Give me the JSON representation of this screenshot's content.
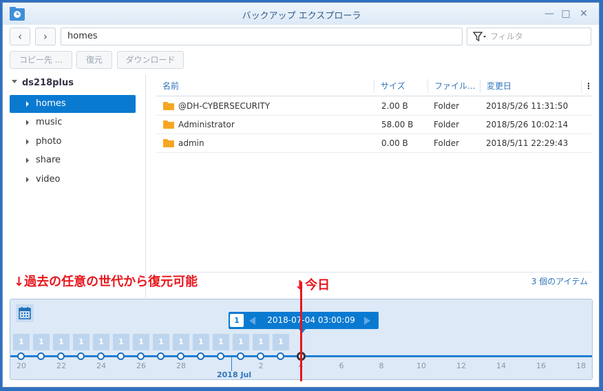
{
  "window": {
    "title": "バックアップ エクスプローラ",
    "minimize_glyph": "—",
    "maximize_glyph": "□",
    "close_glyph": "✕"
  },
  "navigation": {
    "back_glyph": "‹",
    "forward_glyph": "›",
    "path": "homes",
    "filter_placeholder": "フィルタ"
  },
  "actions": {
    "copy_to": "コピー先 ...",
    "restore": "復元",
    "download": "ダウンロード"
  },
  "sidebar": {
    "root": "ds218plus",
    "items": [
      {
        "label": "homes"
      },
      {
        "label": "music"
      },
      {
        "label": "photo"
      },
      {
        "label": "share"
      },
      {
        "label": "video"
      }
    ]
  },
  "table": {
    "headers": {
      "name": "名前",
      "size": "サイズ",
      "type": "ファイル...",
      "modified": "変更日"
    },
    "rows": [
      {
        "name": "@DH-CYBERSECURITY",
        "size": "2.00 B",
        "type": "Folder",
        "modified": "2018/5/26 11:31:50"
      },
      {
        "name": "Administrator",
        "size": "58.00 B",
        "type": "Folder",
        "modified": "2018/5/26 10:02:14"
      },
      {
        "name": "admin",
        "size": "0.00 B",
        "type": "Folder",
        "modified": "2018/5/11 22:29:43"
      }
    ],
    "item_count": "3 個のアイテム"
  },
  "annotations": {
    "left": "↓過去の任意の世代から復元可能",
    "right": "↓今日"
  },
  "timeline": {
    "selected_count": "1",
    "selected_datetime": "2018-07-04 03:00:09",
    "backup_counts": [
      "1",
      "1",
      "1",
      "1",
      "1",
      "1",
      "1",
      "1",
      "1",
      "1",
      "1",
      "1",
      "1",
      "1"
    ],
    "ticks": [
      "20",
      "22",
      "24",
      "26",
      "28",
      "2",
      "4",
      "6",
      "8",
      "10",
      "12",
      "14",
      "16",
      "18"
    ],
    "month_label": "2018 Jul"
  },
  "colors": {
    "accent": "#0a7ad1",
    "annotation_red": "#e8161d",
    "folder": "#f5a623"
  }
}
